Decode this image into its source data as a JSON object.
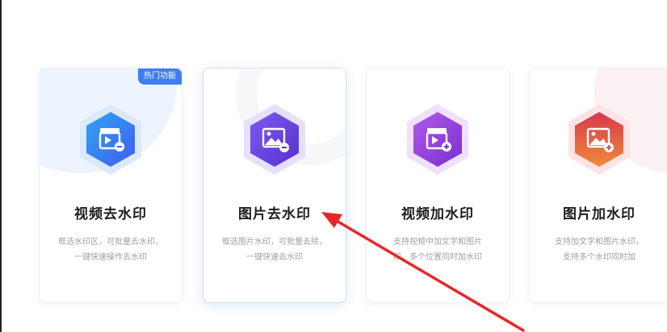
{
  "cards": [
    {
      "title": "视频去水印",
      "desc_line1": "框选水印区，可批量去水印，",
      "desc_line2": "一键快速操作去水印",
      "badge": "热门功能",
      "icon": "video-clapper-minus-icon",
      "gradient": [
        "#2fa6f2",
        "#3f5cf0"
      ],
      "halo": "#dbe9fc"
    },
    {
      "title": "图片去水印",
      "desc_line1": "框选图片水印，可批量去除，",
      "desc_line2": "一键快速去水印",
      "icon": "image-minus-icon",
      "gradient": [
        "#7b5cf0",
        "#5a2fcf"
      ],
      "halo": "#e5e0fb"
    },
    {
      "title": "视频加水印",
      "desc_line1": "支持视频中加文字和图片",
      "desc_line2": "印，多个位置同时加水印",
      "icon": "video-clapper-plus-icon",
      "gradient": [
        "#b05ae8",
        "#7a2fd0"
      ],
      "halo": "#efe0fb"
    },
    {
      "title": "图片加水印",
      "desc_line1": "支持加文字和图片水印，",
      "desc_line2": "支持多个水印同时加",
      "icon": "image-plus-icon",
      "gradient": [
        "#e04a5a",
        "#f08a3a"
      ],
      "halo": "#fbe3e6"
    }
  ],
  "annotation": {
    "color": "#e8262a",
    "icon": "red-arrow-icon"
  }
}
